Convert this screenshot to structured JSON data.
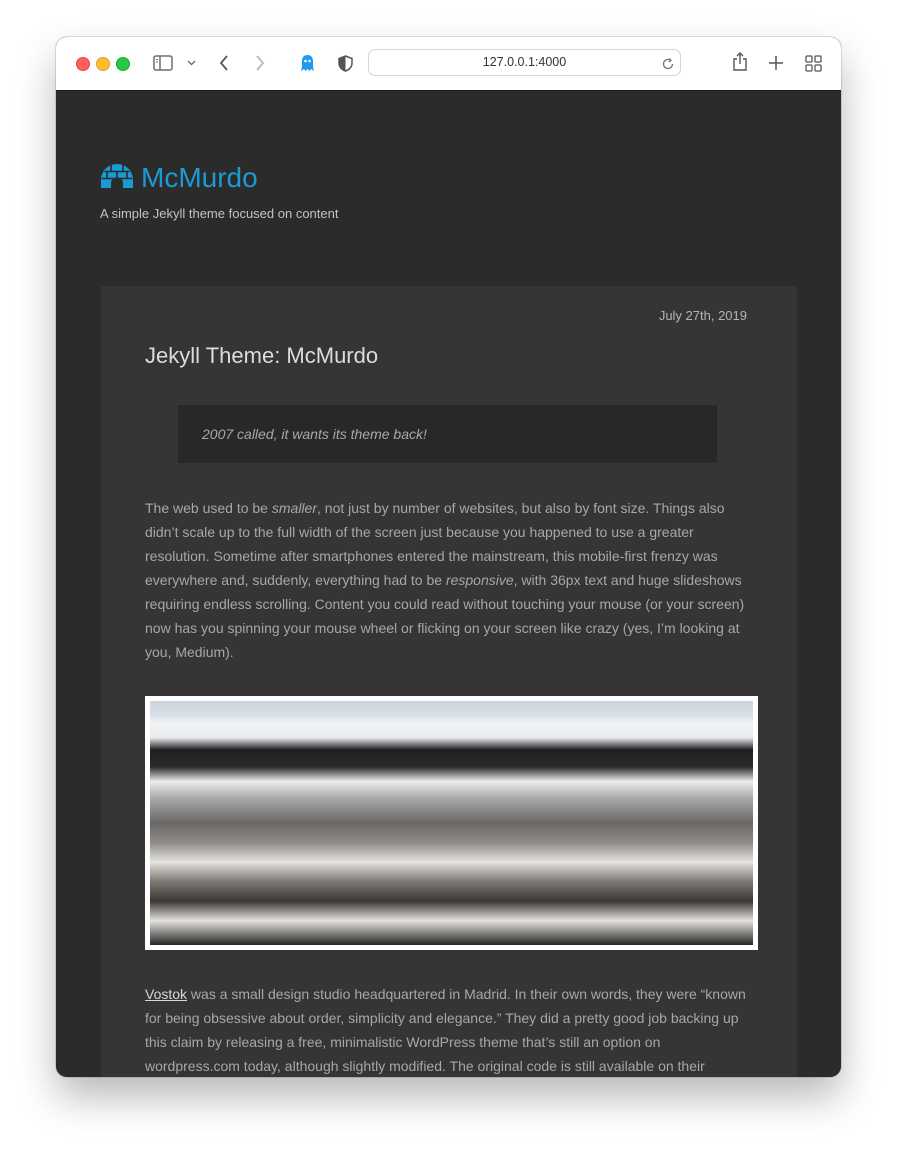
{
  "browser": {
    "url": "127.0.0.1:4000",
    "icons": [
      "sidebar-icon",
      "chevron-down-icon",
      "back-icon",
      "forward-icon",
      "ghostery-icon",
      "shield-icon",
      "reload-icon",
      "share-icon",
      "plus-icon",
      "tabs-grid-icon"
    ]
  },
  "site": {
    "title": "McMurdo",
    "tagline": "A simple Jekyll theme focused on content",
    "accent_color": "#1b9bd4"
  },
  "post": {
    "date": "July 27th, 2019",
    "title": "Jekyll Theme: McMurdo",
    "quote": "2007 called, it wants its theme back!",
    "p1": {
      "a": "The web used to be ",
      "b": "smaller",
      "c": ", not just by number of websites, but also by font size. Things also didn’t scale up to the full width of the screen just because you happened to use a greater resolution. Sometime after smartphones entered the mainstream, this mobile-first frenzy was everywhere and, suddenly, everything had to be ",
      "d": "responsive",
      "e": ", with 36px text and huge slideshows requiring endless scrolling. Content you could read without touching your mouse (or your screen) now has you spinning your mouse wheel or flicking on your screen like crazy (yes, I’m looking at you, Medium)."
    },
    "p2": {
      "link": "Vostok",
      "rest": " was a small design studio headquartered in Madrid. In their own words, they were “known for being obsessive about order, simplicity and elegance.” They did a pretty good job backing up this claim by releasing a free, minimalistic WordPress theme that’s still an option on wordpress.com today, although slightly modified. The original code is still available on their"
    }
  }
}
